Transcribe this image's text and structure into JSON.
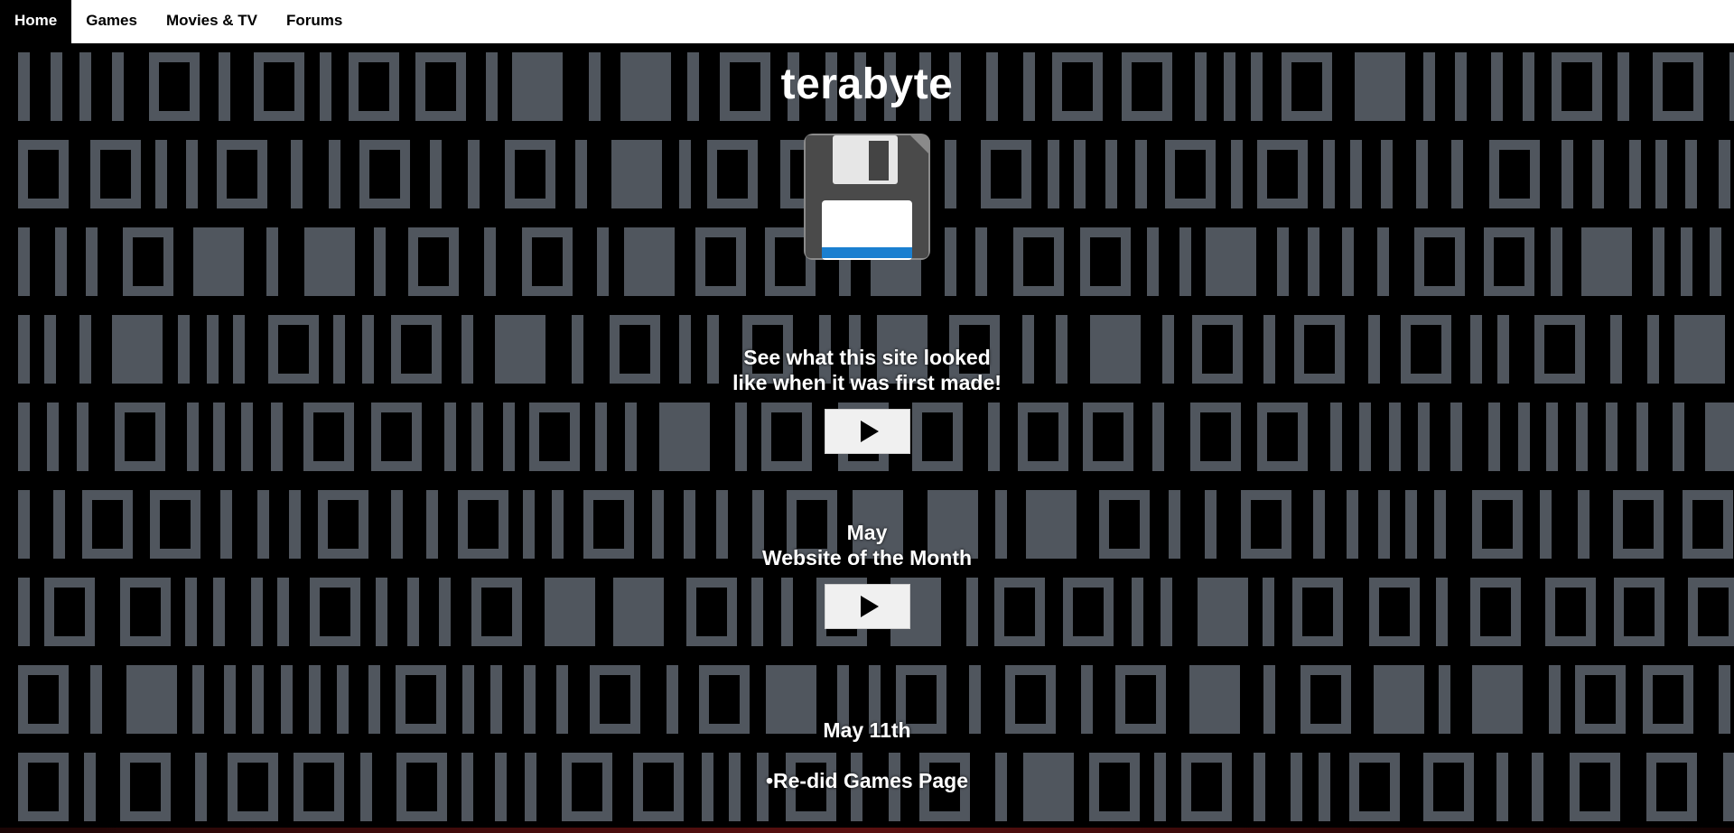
{
  "nav": {
    "items": [
      {
        "label": "Home",
        "active": true
      },
      {
        "label": "Games"
      },
      {
        "label": "Movies & TV"
      },
      {
        "label": "Forums"
      }
    ]
  },
  "hero": {
    "title": "terabyte",
    "icon": "floppy-disk-icon"
  },
  "sections": {
    "original_site": {
      "line1": "See what this site looked",
      "line2": "like when it was first made!",
      "button_icon": "play-icon"
    },
    "website_of_month": {
      "line1": "May",
      "line2": "Website of the Month",
      "button_icon": "play-icon"
    },
    "update": {
      "date": "May 11th",
      "item": "•Re-did Games Page"
    }
  },
  "colors": {
    "background": "#000000",
    "pattern": "#50565e",
    "nav_bg": "#ffffff",
    "floppy_label_stripe": "#1a7fd0"
  }
}
